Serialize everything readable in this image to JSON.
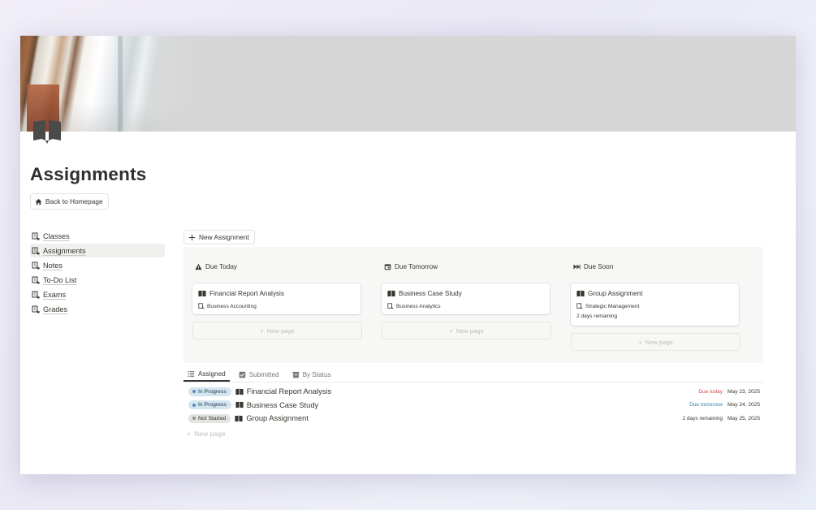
{
  "page": {
    "title": "Assignments",
    "back_button": "Back to Homepage",
    "new_assignment_button": "New Assignment"
  },
  "sidebar": {
    "items": [
      {
        "label": "Classes",
        "active": false
      },
      {
        "label": "Assignments",
        "active": true
      },
      {
        "label": "Notes",
        "active": false
      },
      {
        "label": "To-Do List",
        "active": false
      },
      {
        "label": "Exams",
        "active": false
      },
      {
        "label": "Grades",
        "active": false
      }
    ]
  },
  "board": {
    "columns": [
      {
        "heading": "Due Today",
        "icon": "warning-icon",
        "card": {
          "title": "Financial Report Analysis",
          "class": "Business Accounting",
          "extra": ""
        },
        "new_page": "New page"
      },
      {
        "heading": "Due Tomorrow",
        "icon": "calendar-icon",
        "card": {
          "title": "Business Case Study",
          "class": "Business Analytics",
          "extra": ""
        },
        "new_page": "New page"
      },
      {
        "heading": "Due Soon",
        "icon": "fast-forward-icon",
        "card": {
          "title": "Group Assignment",
          "class": "Strategic Management",
          "extra": "2 days remaining"
        },
        "new_page": "New page"
      }
    ]
  },
  "tabs": [
    {
      "label": "Assigned",
      "active": true,
      "icon": "list-icon"
    },
    {
      "label": "Submitted",
      "active": false,
      "icon": "checkbox-icon"
    },
    {
      "label": "By Status",
      "active": false,
      "icon": "archive-icon"
    }
  ],
  "table": {
    "rows": [
      {
        "status": "In Progress",
        "title": "Financial Report Analysis",
        "due": "Due today",
        "date": "May 23, 2025"
      },
      {
        "status": "In Progress",
        "title": "Business Case Study",
        "due": "Due tomorrow",
        "date": "May 24, 2025"
      },
      {
        "status": "Not Started",
        "title": "Group Assignment",
        "due": "2 days remaining",
        "date": "May 25, 2025"
      }
    ],
    "new_page": "New page"
  },
  "colors": {
    "in_progress_bg": "#d3e5ef",
    "in_progress_dot": "#5e87c9",
    "not_started_bg": "#e3e2e0",
    "not_started_dot": "#91918e",
    "due_today": "#d44c47",
    "due_tomorrow": "#337ea9",
    "due_soon": "#37352f"
  }
}
